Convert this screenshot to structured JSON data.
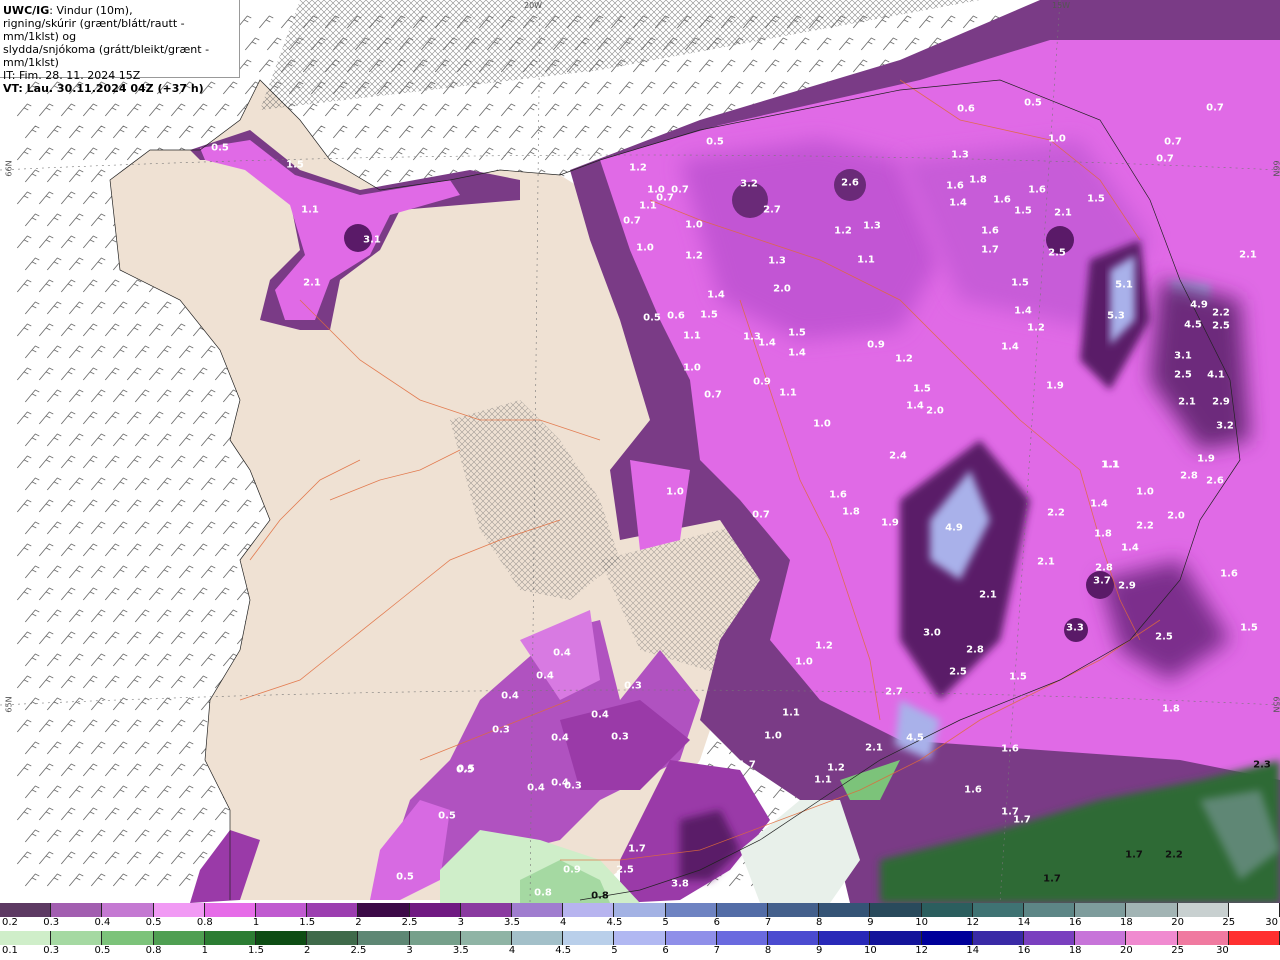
{
  "title": {
    "model": "UWC/IG",
    "line1": ": Vindur (10m),",
    "line2": "rigning/skúrir (grænt/blátt/rautt - mm/1klst) og",
    "line3": "slydda/snjókoma (grátt/bleikt/grænt - mm/1klst)",
    "it": "IT: Fim. 28. 11. 2024 15Z",
    "vt": "VT: Lau. 30.11.2024 04Z (+37 h)"
  },
  "grid_labels": [
    "20W",
    "15W",
    "66N",
    "66N",
    "65N",
    "65N"
  ],
  "colors": {
    "land": "#efe1d3",
    "sea": "#ffffff",
    "snow_light": "#d95ce6",
    "snow_mid": "#b44cc4",
    "snow_dark": "#6a2a78",
    "snow_deep": "#3a0c46",
    "snow_blue": "#a9b1ea",
    "rain_green": "#4f8f52",
    "rain_light_green": "#cfeec9",
    "roads": "#e06a3a"
  },
  "precip_labels": [
    "0.5",
    "1.5",
    "1.1",
    "3.1",
    "2.1",
    "0.5",
    "0.7",
    "1.2",
    "1.0",
    "0.7",
    "1.1",
    "1.0",
    "0.7",
    "1.0",
    "3.2",
    "2.7",
    "2.6",
    "1.3",
    "1.2",
    "1.3",
    "1.1",
    "1.2",
    "1.4",
    "1.5",
    "0.5",
    "0.6",
    "1.1",
    "1.0",
    "2.0",
    "1.3",
    "1.5",
    "1.4",
    "1.4",
    "0.9",
    "1.1",
    "0.7",
    "1.3",
    "1.8",
    "1.6",
    "1.6",
    "2.1",
    "1.5",
    "1.4",
    "1.7",
    "1.6",
    "1.5",
    "2.5",
    "0.6",
    "0.5",
    "1.0",
    "0.7",
    "0.7",
    "0.7",
    "2.1",
    "5.1",
    "5.3",
    "4.9",
    "2.2",
    "4.5",
    "2.5",
    "1.6",
    "1.5",
    "1.4",
    "1.2",
    "1.4",
    "1.9",
    "0.9",
    "1.2",
    "1.5",
    "1.4",
    "2.0",
    "3.1",
    "2.5",
    "4.1",
    "2.1",
    "2.9",
    "3.2",
    "1.0",
    "2.4",
    "1.1",
    "1.9",
    "2.8",
    "2.6",
    "1.0",
    "1.6",
    "1.8",
    "1.9",
    "4.9",
    "2.2",
    "1.4",
    "1.8",
    "2.2",
    "2.0",
    "0.7",
    "1.0",
    "1.4",
    "2.1",
    "1.6",
    "3.7",
    "2.9",
    "1.1",
    "2.1",
    "3.3",
    "1.5",
    "1.2",
    "1.0",
    "3.0",
    "2.8",
    "2.5",
    "2.5",
    "2.7",
    "1.5",
    "0.4",
    "0.4",
    "0.3",
    "0.4",
    "0.4",
    "0.3",
    "0.4",
    "0.5",
    "0.3",
    "0.4",
    "1.1",
    "1.8",
    "1.0",
    "1.7",
    "4.5",
    "2.1",
    "2.8",
    "1.6",
    "1.2",
    "1.1",
    "1.7",
    "1.7",
    "1.6",
    "2.2",
    "1.7",
    "1.7",
    "0.5",
    "0.4",
    "0.3",
    "0.5",
    "0.8",
    "0.9",
    "1.7",
    "2.5",
    "3.8",
    "0.5",
    "0.8",
    "2.3"
  ],
  "legend_top": {
    "colors": [
      "#5d3a63",
      "#a25eb0",
      "#c479d2",
      "#f19af4",
      "#e66ce8",
      "#c05ad0",
      "#9c3eb0",
      "#3c0a47",
      "#701a82",
      "#8a3aa0",
      "#a07dcf",
      "#b7b4ef",
      "#a3b2e4",
      "#6e83c2",
      "#536da7",
      "#44608c",
      "#355476",
      "#294a5c",
      "#2b5e5e",
      "#3f7373",
      "#5d8686",
      "#7e9c9c",
      "#a2b4b4",
      "#c8d0d0",
      "#ffffff"
    ],
    "ticks": [
      "0.2",
      "0.3",
      "0.4",
      "0.5",
      "0.8",
      "1",
      "1.5",
      "2",
      "2.5",
      "3",
      "3.5",
      "4",
      "4.5",
      "5",
      "6",
      "7",
      "8",
      "9",
      "10",
      "12",
      "14",
      "16",
      "18",
      "20",
      "25",
      "30"
    ]
  },
  "legend_bottom": {
    "colors": [
      "#cfeec9",
      "#a5d9a2",
      "#7cc37a",
      "#4f9f52",
      "#2c7d33",
      "#0e4d14",
      "#3f6a4a",
      "#5e8774",
      "#76a08b",
      "#8fb4a5",
      "#a3c0c9",
      "#b9cfea",
      "#b1b8f2",
      "#8f8fe9",
      "#6a6adf",
      "#4b4bd0",
      "#2929b8",
      "#14149a",
      "#00009a",
      "#3a2aa6",
      "#7a3fbf",
      "#c774d9",
      "#f08ad0",
      "#f07aa0",
      "#ff3030"
    ],
    "ticks": [
      "0.1",
      "0.3",
      "0.5",
      "0.8",
      "1",
      "1.5",
      "2",
      "2.5",
      "3",
      "3.5",
      "4",
      "4.5",
      "5",
      "6",
      "7",
      "8",
      "9",
      "10",
      "12",
      "14",
      "16",
      "18",
      "20",
      "25",
      "30"
    ]
  }
}
